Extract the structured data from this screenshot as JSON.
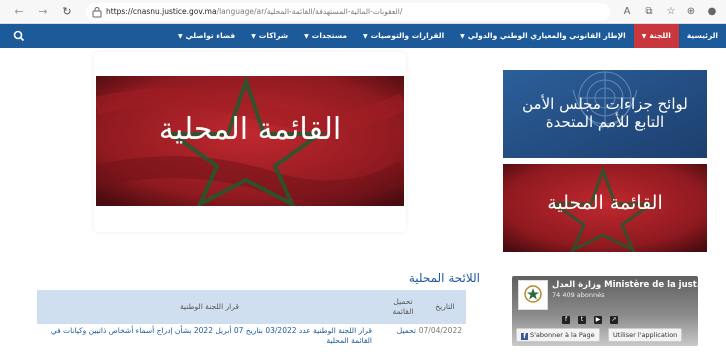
{
  "browser": {
    "url_host": "https://cnasnu.justice.gov.ma",
    "url_path": "/language/ar/العقوبات-المالية-المستهدفة/القائمة-المحلية/"
  },
  "nav": {
    "items": [
      {
        "label": "الرئيسية",
        "active": false,
        "caret": false
      },
      {
        "label": "اللجنة",
        "active": true,
        "caret": true
      },
      {
        "label": "الإطار القانوني والمعياري الوطني والدولي",
        "active": false,
        "caret": true
      },
      {
        "label": "القرارات والتوصيات",
        "active": false,
        "caret": true
      },
      {
        "label": "مستجدات",
        "active": false,
        "caret": true
      },
      {
        "label": "شراكات",
        "active": false,
        "caret": true
      },
      {
        "label": "فضاء تواصلي",
        "active": false,
        "caret": true
      }
    ],
    "caret_glyph": "▼"
  },
  "hero": {
    "banner_text": "القائمة المحلية"
  },
  "sidebar": {
    "un_banner_line1": "لوائح جزاءات مجلس الأمن",
    "un_banner_line2": "التابع للأمم المتحدة",
    "local_banner_text": "القائمة المحلية"
  },
  "section": {
    "title": "اللائحة المحلية"
  },
  "table": {
    "headers": {
      "date": "التاريخ",
      "download_line1": "تحميل",
      "download_line2": "القائمة",
      "decision": "قرار اللجنة الوطنية"
    },
    "rows": [
      {
        "date": "07/04/2022",
        "download": "تحميل",
        "decision_line1": "قرار اللجنة الوطنية عدد 03/2022 بتاريخ 07 أبريل 2022 بشأن إدراج أسماء أشخاص ذاتيين وكيانات في",
        "decision_line2": "القائمة المحلية"
      }
    ]
  },
  "fb_widget": {
    "page_name": "Ministère de la just...",
    "page_name_ar": "وزارة العدل",
    "subscribers": "74 409 abonnés",
    "subscribe_label": "S'abonner à la Page",
    "app_label": "Utiliser l'application"
  },
  "colors": {
    "nav_blue": "#1c5a9a",
    "active_red": "#c7373d",
    "flag_red": "#b2262d",
    "table_head": "#cfdff0"
  }
}
